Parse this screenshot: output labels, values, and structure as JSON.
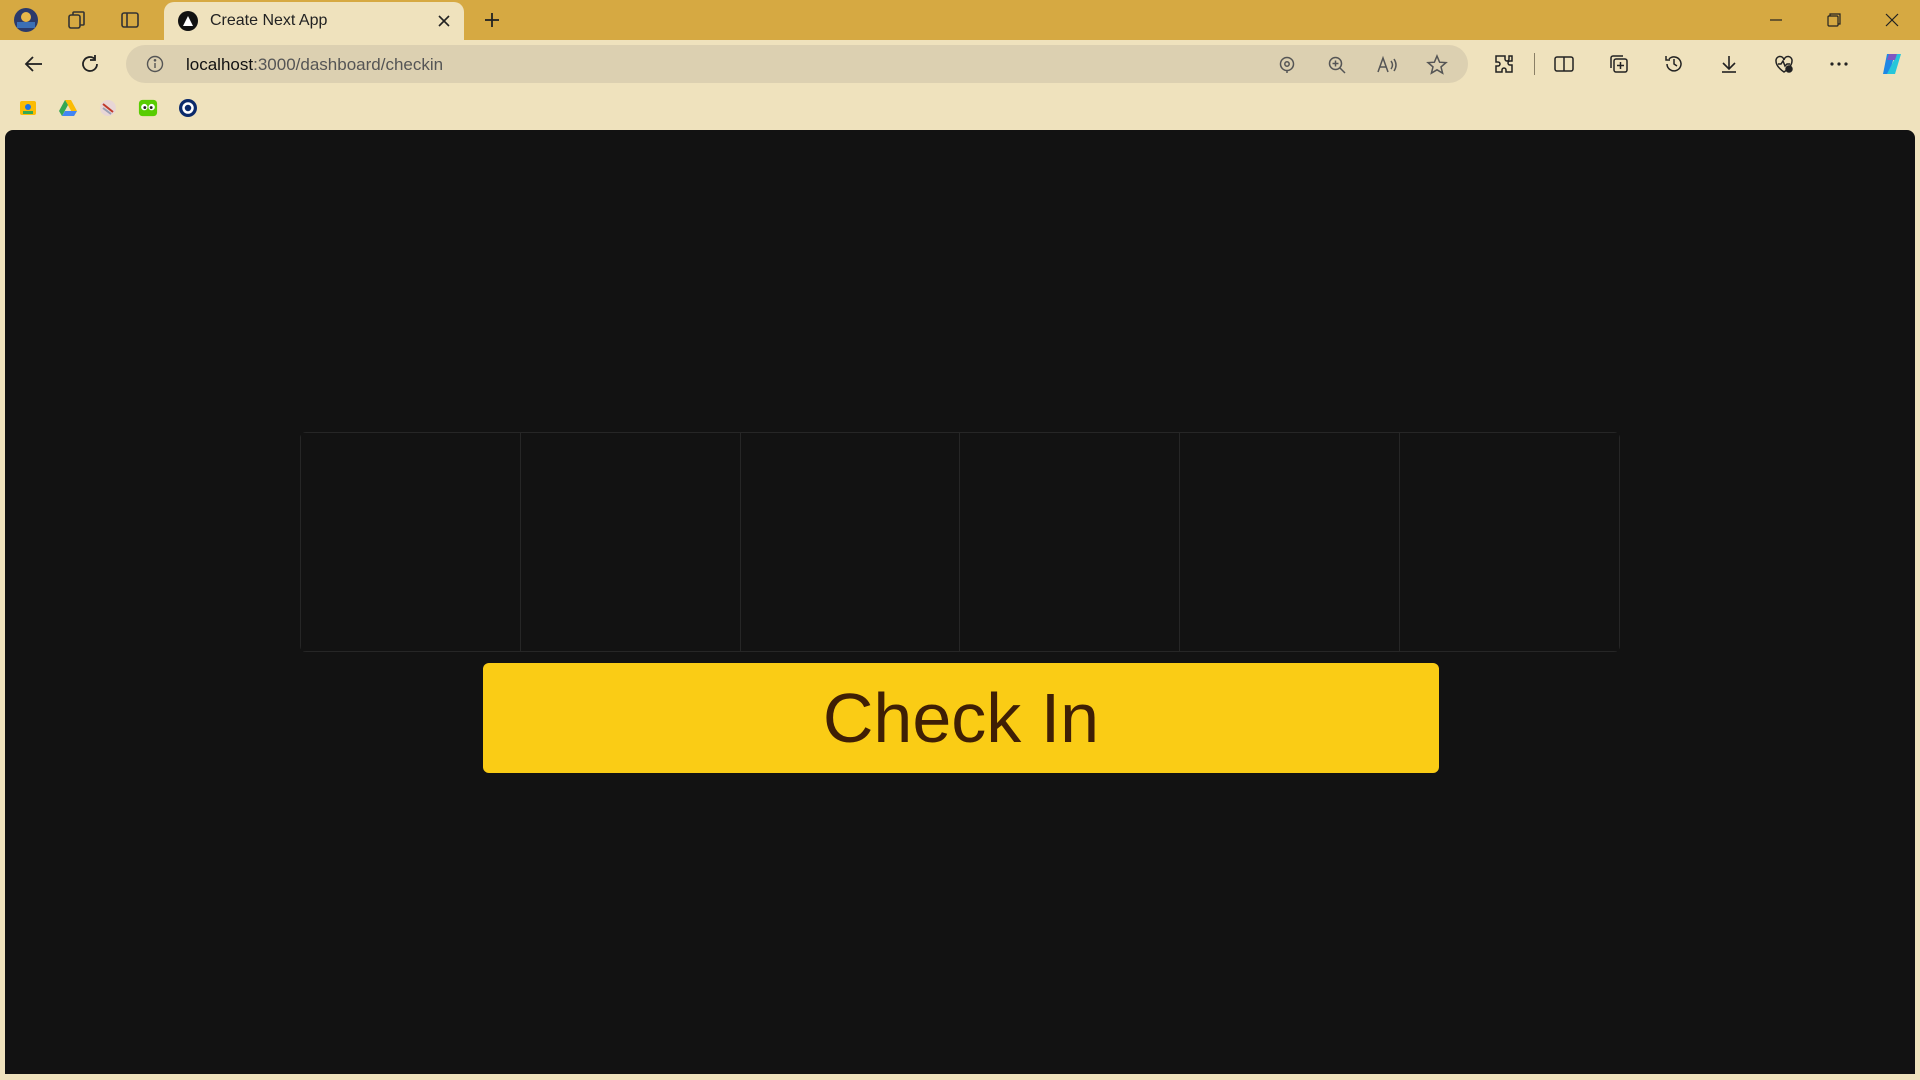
{
  "browser": {
    "tab": {
      "title": "Create Next App"
    },
    "address_bar": {
      "host": "localhost",
      "path": ":3000/dashboard/checkin"
    },
    "colors": {
      "frame": "#d6a942",
      "toolbar": "#efe2bd",
      "omnibox": "#dcd0b1"
    },
    "icons": {
      "left": [
        "profile-icon",
        "workspaces-icon",
        "vertical-tabs-icon"
      ],
      "toolbar": [
        "back-icon",
        "refresh-icon",
        "info-icon",
        "location-icon",
        "zoom-icon",
        "read-aloud-icon",
        "favorite-icon",
        "extensions-icon",
        "split-screen-icon",
        "collections-icon",
        "history-icon",
        "downloads-icon",
        "performance-icon",
        "more-icon",
        "copilot-icon"
      ],
      "favorites": [
        "google-contacts-icon",
        "google-drive-icon",
        "striped-app-icon",
        "duolingo-icon",
        "circle-app-icon"
      ]
    }
  },
  "page": {
    "background": "#121212",
    "code_inputs": [
      "",
      "",
      "",
      "",
      "",
      ""
    ],
    "checkin_button": {
      "label": "Check In",
      "color": "#facc15",
      "text_color": "#3f1f05"
    }
  }
}
